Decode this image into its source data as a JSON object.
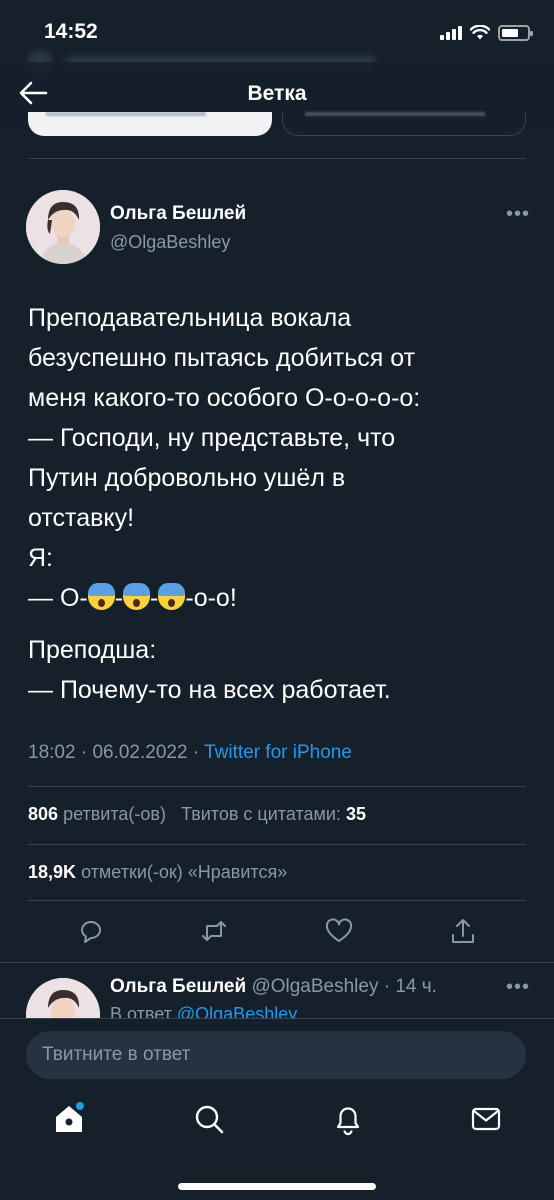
{
  "status_bar": {
    "time": "14:52",
    "battery_level": 0.65
  },
  "header": {
    "title": "Ветка"
  },
  "tweet": {
    "author_name": "Ольга Бешлей",
    "author_handle": "@OlgaBeshley",
    "paragraph1": [
      "Преподавательница вокала",
      "безуспешно пытаясь добиться от",
      "меня какого-то особого О-о-о-о-о:",
      "— Господи, ну представьте, что",
      "Путин добровольно ушёл в",
      "отставку!"
    ],
    "paragraph2": {
      "speaker": "Я:",
      "seg1": "— О-",
      "seg2": "-",
      "seg3": "-",
      "seg4": "-о-о!"
    },
    "paragraph3": [
      "Преподша:",
      "— Почему-то на всех работает."
    ],
    "time": "18:02",
    "date": "06.02.2022",
    "separator": " · ",
    "source": "Twitter for iPhone"
  },
  "stats": {
    "retweets_count": "806",
    "retweets_label": "ретвита(-ов)",
    "quotes_label": "Твитов с цитатами:",
    "quotes_count": "35",
    "likes_count": "18,9K",
    "likes_label": "отметки(-ок) «Нравится»"
  },
  "reply": {
    "author_name": "Ольга Бешлей",
    "handle_time": "@OlgaBeshley · 14 ч.",
    "reply_prefix": "В ответ ",
    "reply_mention": "@OlgaBeshley"
  },
  "compose": {
    "placeholder": "Твитните в ответ"
  },
  "icons": {
    "back": "back-arrow-icon",
    "reply": "reply-icon",
    "retweet": "retweet-icon",
    "like": "heart-icon",
    "share": "share-icon",
    "home": "home-icon",
    "search": "search-icon",
    "notifications": "bell-icon",
    "messages": "mail-icon"
  },
  "colors": {
    "background": "#15202b",
    "accent": "#1d9bf0",
    "secondary_text": "#8899a6",
    "divider": "#38444d"
  }
}
